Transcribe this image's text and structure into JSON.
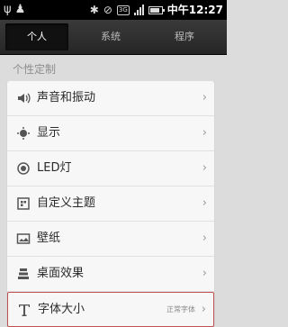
{
  "status_bar": {
    "time": "中午12:27",
    "network_badge": "3G",
    "icons": [
      "usb-icon",
      "android-icon",
      "bluetooth-icon",
      "vibrate-icon",
      "3g-icon",
      "signal-icon",
      "battery-icon"
    ]
  },
  "tabs": [
    {
      "label": "个人",
      "active": true
    },
    {
      "label": "系统",
      "active": false
    },
    {
      "label": "程序",
      "active": false
    }
  ],
  "section_title": "个性定制",
  "items": [
    {
      "label": "声音和振动",
      "value": "",
      "icon": "speaker-icon"
    },
    {
      "label": "显示",
      "value": "",
      "icon": "display-icon"
    },
    {
      "label": "LED灯",
      "value": "",
      "icon": "led-icon"
    },
    {
      "label": "自定义主题",
      "value": "",
      "icon": "theme-icon"
    },
    {
      "label": "壁纸",
      "value": "",
      "icon": "wallpaper-icon"
    },
    {
      "label": "桌面效果",
      "value": "",
      "icon": "desktop-effect-icon"
    },
    {
      "label": "字体大小",
      "value": "正常字体",
      "icon": "font-icon"
    }
  ],
  "colors": {
    "background": "#dcdcdc",
    "tab_bar": "#2e2e2e",
    "focus_border": "#c05050"
  }
}
